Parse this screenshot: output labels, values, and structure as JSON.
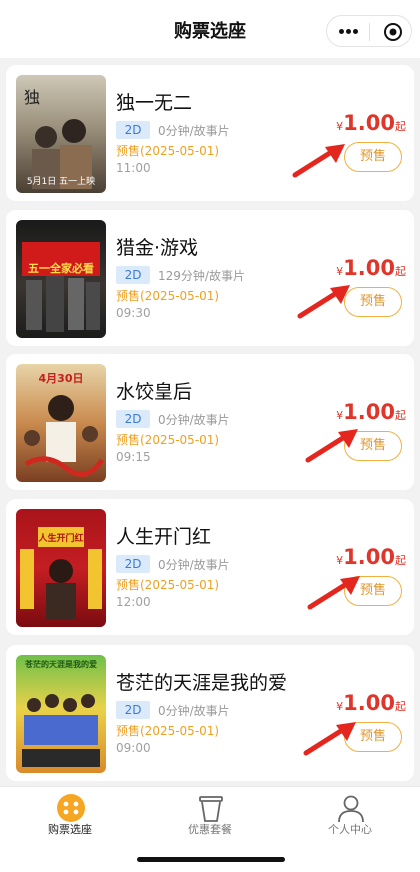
{
  "header": {
    "title": "购票选座"
  },
  "movies": [
    {
      "title": "独一无二",
      "format": "2D",
      "meta": "0分钟/故事片",
      "presale": "预售(2025-05-01)",
      "time": "11:00",
      "currency": "¥",
      "price": "1.00",
      "price_suffix": "起",
      "button": "预售",
      "poster_text": "5月1日 五一上映"
    },
    {
      "title": "猎金·游戏",
      "format": "2D",
      "meta": "129分钟/故事片",
      "presale": "预售(2025-05-01)",
      "time": "09:30",
      "currency": "¥",
      "price": "1.00",
      "price_suffix": "起",
      "button": "预售",
      "poster_text": "五一全家必看"
    },
    {
      "title": "水饺皇后",
      "format": "2D",
      "meta": "0分钟/故事片",
      "presale": "预售(2025-05-01)",
      "time": "09:15",
      "currency": "¥",
      "price": "1.00",
      "price_suffix": "起",
      "button": "预售",
      "poster_text": "4月30日"
    },
    {
      "title": "人生开门红",
      "format": "2D",
      "meta": "0分钟/故事片",
      "presale": "预售(2025-05-01)",
      "time": "12:00",
      "currency": "¥",
      "price": "1.00",
      "price_suffix": "起",
      "button": "预售",
      "poster_text": "人生开门红"
    },
    {
      "title": "苍茫的天涯是我的爱",
      "format": "2D",
      "meta": "0分钟/故事片",
      "presale": "预售(2025-05-01)",
      "time": "09:00",
      "currency": "¥",
      "price": "1.00",
      "price_suffix": "起",
      "button": "预售",
      "poster_text": "苍茫的天涯是我的爱"
    }
  ],
  "tabbar": {
    "items": [
      {
        "label": "购票选座",
        "icon": "ticket-seat-icon",
        "active": true
      },
      {
        "label": "优惠套餐",
        "icon": "cup-icon",
        "active": false
      },
      {
        "label": "个人中心",
        "icon": "person-icon",
        "active": false
      }
    ]
  },
  "colors": {
    "price": "#e0352b",
    "presale": "#f0a020",
    "accent": "#f5a623",
    "badge_bg": "#dbeafa",
    "badge_text": "#3a7bd5"
  }
}
